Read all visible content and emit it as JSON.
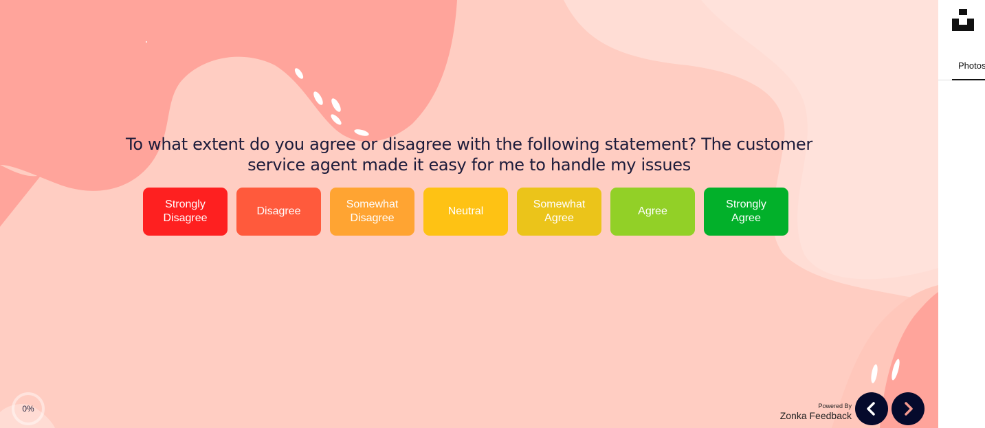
{
  "survey": {
    "question": "To what extent do you agree or disagree with the following statement? The customer service agent made it easy for me to handle my issues",
    "options": [
      {
        "label": "Strongly Disagree",
        "color": "#fe2020"
      },
      {
        "label": "Disagree",
        "color": "#ff5a3c"
      },
      {
        "label": "Somewhat Disagree",
        "color": "#ffa432"
      },
      {
        "label": "Neutral",
        "color": "#fec214"
      },
      {
        "label": "Somewhat Agree",
        "color": "#ebc41a"
      },
      {
        "label": "Agree",
        "color": "#92d027"
      },
      {
        "label": "Strongly Agree",
        "color": "#02b02a"
      }
    ],
    "progress": {
      "value_percent": 0,
      "label": "0%"
    },
    "powered_by": {
      "small": "Powered By",
      "brand": "Zonka Feedback"
    },
    "nav": {
      "prev_icon": "chevron-left-icon",
      "next_icon": "chevron-right-icon"
    },
    "colors": {
      "background": "#ffcdc2",
      "blob_dark": "#ffa49b",
      "blob_light": "#ffddd5",
      "question_text": "#1c1b3a",
      "nav_button": "#050a2c"
    }
  },
  "sidebar": {
    "logo_icon": "unsplash-logo-icon",
    "tab": {
      "icon": "photo-icon",
      "label": "Photos"
    }
  }
}
